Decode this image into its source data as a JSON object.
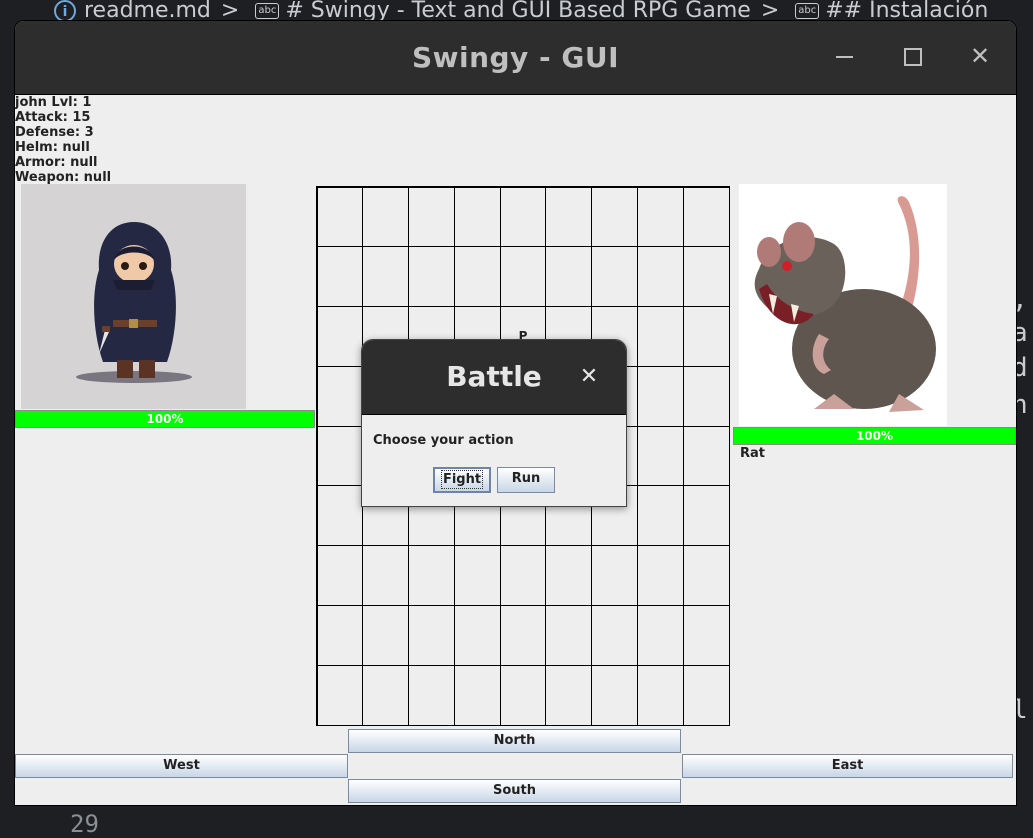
{
  "editor": {
    "breadcrumb_file": "readme.md",
    "breadcrumb_h1": "# Swingy - Text and GUI Based RPG Game",
    "breadcrumb_h2": "## Instalación",
    "abc_icon": "abc",
    "line_number": "29",
    "side_glyphs": [
      ",",
      "a",
      "d",
      "n",
      "l"
    ]
  },
  "window": {
    "title": "Swingy - GUI",
    "minimize_icon": "minimize-icon",
    "maximize_icon": "maximize-icon",
    "close_label": "✕"
  },
  "hero": {
    "stats": [
      "john Lvl: 1",
      "Attack: 15",
      "Defense: 3",
      "Helm: null",
      "Armor: null",
      "Weapon: null"
    ],
    "health_label": "100%",
    "health_value": 1.0,
    "bar_color": "#00ff00"
  },
  "enemy": {
    "name": "Rat",
    "health_label": "100%",
    "health_value": 1.0
  },
  "map": {
    "size": 9,
    "player_marker": "P"
  },
  "controls": {
    "north": "North",
    "west": "West",
    "east": "East",
    "south": "South"
  },
  "dialog": {
    "title": "Battle",
    "close_label": "✕",
    "message": "Choose your action",
    "fight_label": "Fight",
    "run_label": "Run"
  }
}
